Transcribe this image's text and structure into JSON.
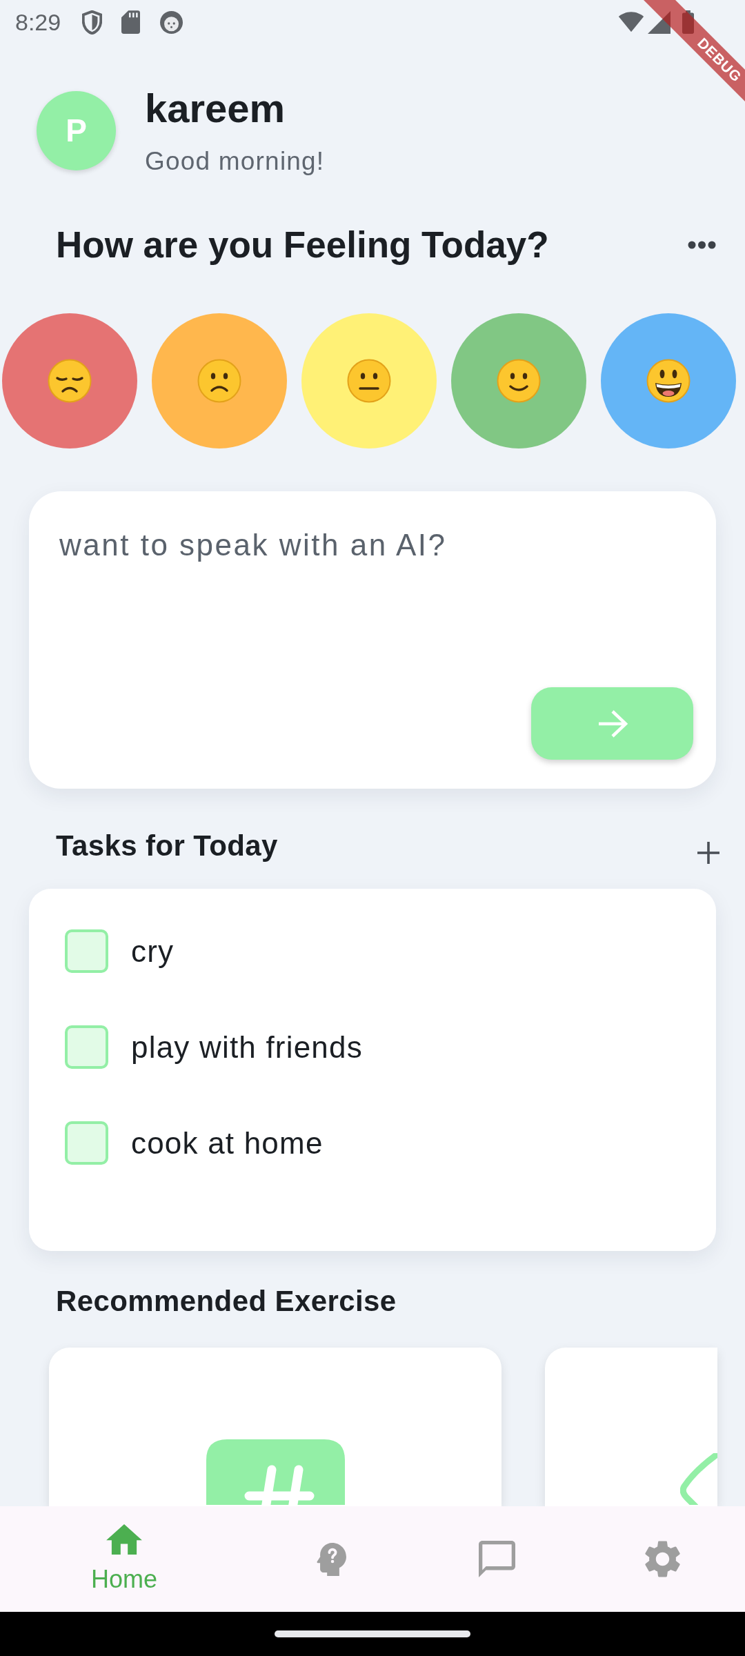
{
  "status_bar": {
    "time": "8:29"
  },
  "debug_banner": {
    "label": "DEBUG"
  },
  "header": {
    "avatar_letter": "P",
    "name": "kareem",
    "greeting": "Good morning!"
  },
  "mood_section": {
    "title": "How are you Feeling Today?",
    "moods": [
      {
        "kind": "sad",
        "color": "#e57373"
      },
      {
        "kind": "frowning",
        "color": "#ffb74d"
      },
      {
        "kind": "neutral",
        "color": "#fff176"
      },
      {
        "kind": "smiling",
        "color": "#81c784"
      },
      {
        "kind": "grinning",
        "color": "#64b5f6"
      }
    ]
  },
  "ai_prompt": {
    "placeholder": "want to speak with an AI?"
  },
  "tasks": {
    "title": "Tasks for Today",
    "items": [
      {
        "label": "cry",
        "checked": false
      },
      {
        "label": "play with friends",
        "checked": false
      },
      {
        "label": "cook at home",
        "checked": false
      }
    ]
  },
  "exercises": {
    "title": "Recommended Exercise"
  },
  "bottom_nav": {
    "items": [
      {
        "kind": "home",
        "label": "Home",
        "selected": true
      },
      {
        "kind": "help",
        "selected": false
      },
      {
        "kind": "chat",
        "selected": false
      },
      {
        "kind": "settings",
        "selected": false
      }
    ]
  }
}
